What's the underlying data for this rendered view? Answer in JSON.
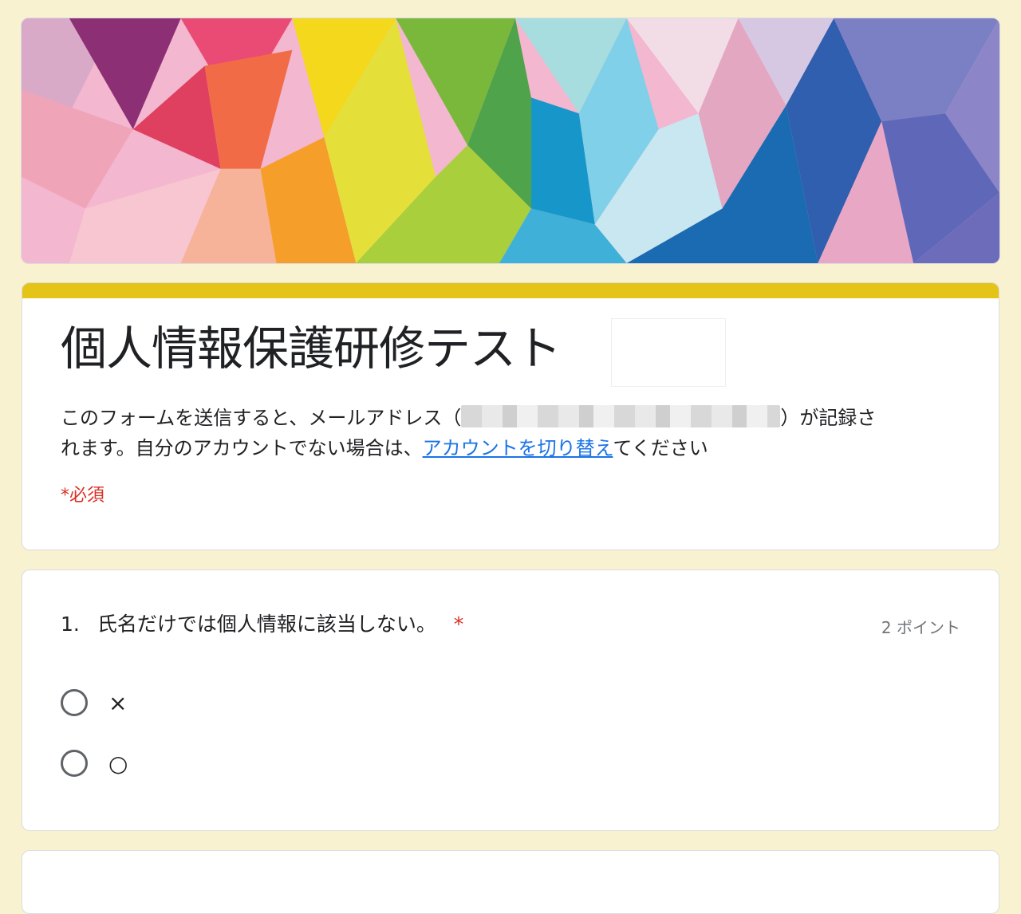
{
  "form": {
    "title": "個人情報保護研修テスト",
    "description_prefix": "このフォームを送信すると、メールアドレス（",
    "description_suffix": "）が記録さ",
    "description_line2_prefix": "れます。自分のアカウントでない場合は、",
    "switch_account_link": "アカウントを切り替え",
    "description_line2_suffix": "てください",
    "required_note": "*必須",
    "accent_color": "#e4c416",
    "background_color": "#f8f2d0"
  },
  "questions": [
    {
      "number": "1.",
      "text": "氏名だけでは個人情報に該当しない。",
      "required_mark": "*",
      "points": "2 ポイント",
      "options": [
        {
          "label": "×"
        },
        {
          "label": "○"
        }
      ]
    }
  ],
  "icons": {
    "radio": "radio-button-unchecked-icon"
  }
}
